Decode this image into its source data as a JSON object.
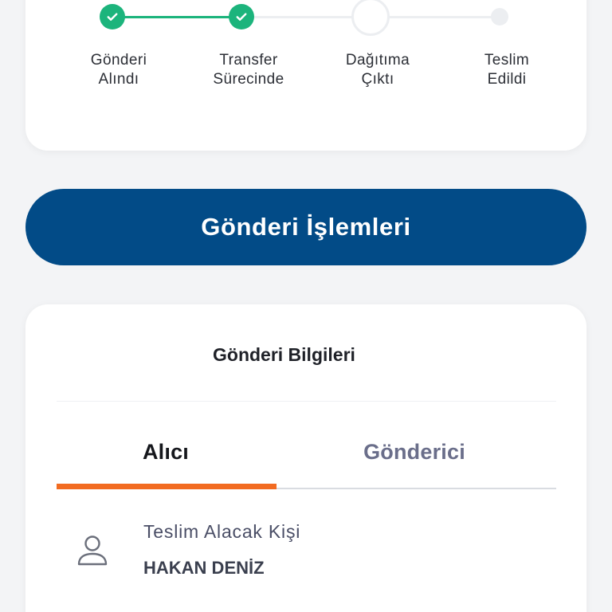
{
  "progress": {
    "steps": [
      {
        "line1": "Gönderi",
        "line2": "Alındı",
        "status": "done"
      },
      {
        "line1": "Transfer",
        "line2": "Sürecinde",
        "status": "done"
      },
      {
        "line1": "Dağıtıma",
        "line2": "Çıktı",
        "status": "current"
      },
      {
        "line1": "Teslim",
        "line2": "Edildi",
        "status": "future"
      }
    ],
    "colors": {
      "done": "#1cb47c",
      "pending": "#eceef1"
    }
  },
  "actions": {
    "main_button_label": "Gönderi İşlemleri",
    "color": "#024b87"
  },
  "shipment_info": {
    "title": "Gönderi Bilgileri",
    "tabs": [
      {
        "label": "Alıcı",
        "active": true
      },
      {
        "label": "Gönderici",
        "active": false
      }
    ],
    "accent_color": "#f26b21",
    "recipient": {
      "icon": "person-icon",
      "label": "Teslim Alacak Kişi",
      "value": "HAKAN DENİZ"
    }
  }
}
